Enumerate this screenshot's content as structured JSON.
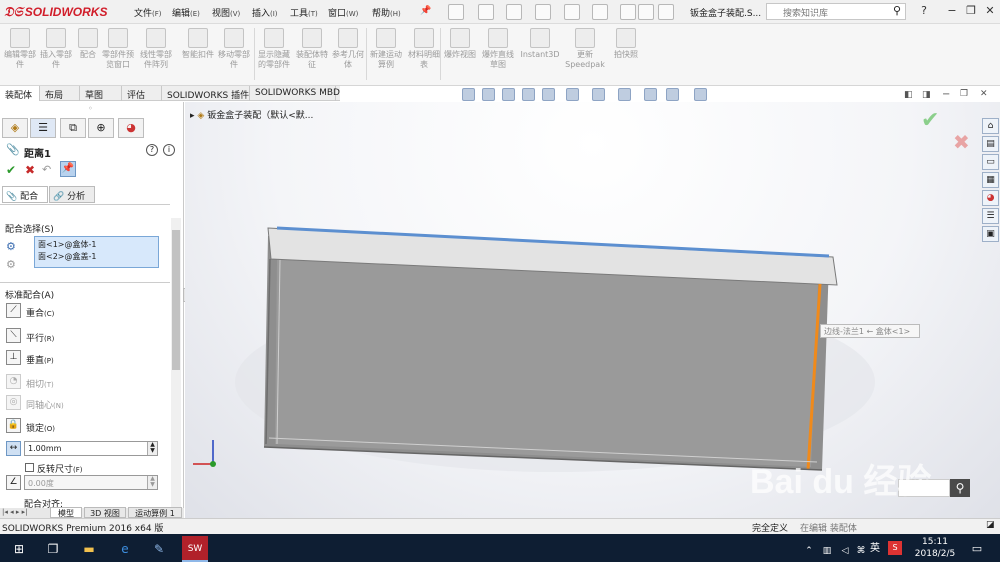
{
  "app": {
    "brand": "SOLIDWORKS",
    "document_title": "钣金盒子装配.S..."
  },
  "menu": [
    {
      "label": "文件",
      "key": "(F)"
    },
    {
      "label": "编辑",
      "key": "(E)"
    },
    {
      "label": "视图",
      "key": "(V)"
    },
    {
      "label": "插入",
      "key": "(I)"
    },
    {
      "label": "工具",
      "key": "(T)"
    },
    {
      "label": "窗口",
      "key": "(W)"
    },
    {
      "label": "帮助",
      "key": "(H)"
    }
  ],
  "search": {
    "placeholder": "搜索知识库"
  },
  "window_buttons": {
    "help": "?",
    "minimize": "−",
    "restore": "❐",
    "close": "✕"
  },
  "ribbon": [
    {
      "label": "编辑零部件"
    },
    {
      "label": "插入零部件"
    },
    {
      "label": "配合"
    },
    {
      "label": "零部件预览窗口"
    },
    {
      "label": "线性零部件阵列"
    },
    {
      "label": "智能扣件"
    },
    {
      "label": "移动零部件"
    },
    {
      "label": "显示隐藏的零部件"
    },
    {
      "label": "装配体特征"
    },
    {
      "label": "参考几何体"
    },
    {
      "label": "新建运动算例"
    },
    {
      "label": "材料明细表"
    },
    {
      "label": "爆炸视图"
    },
    {
      "label": "爆炸直线草图"
    },
    {
      "label": "Instant3D"
    },
    {
      "label": "更新Speedpak"
    },
    {
      "label": "拍快照"
    }
  ],
  "tabs": [
    "装配体",
    "布局",
    "草图",
    "评估",
    "SOLIDWORKS 插件",
    "SOLIDWORKS MBD"
  ],
  "property_manager": {
    "title": "距离1",
    "tab_mate": "配合",
    "tab_analysis": "分析",
    "section_selections": "配合选择(S)",
    "selections": [
      "面<1>@盒体-1",
      "面<2>@盒盖-1"
    ],
    "section_standard": "标准配合(A)",
    "mates": [
      {
        "label": "重合",
        "key": "(C)",
        "icon": "coincident-icon",
        "enabled": true
      },
      {
        "label": "平行",
        "key": "(R)",
        "icon": "parallel-icon",
        "enabled": true
      },
      {
        "label": "垂直",
        "key": "(P)",
        "icon": "perpendicular-icon",
        "enabled": true
      },
      {
        "label": "相切",
        "key": "(T)",
        "icon": "tangent-icon",
        "enabled": false
      },
      {
        "label": "同轴心",
        "key": "(N)",
        "icon": "concentric-icon",
        "enabled": false
      },
      {
        "label": "锁定",
        "key": "(O)",
        "icon": "lock-icon",
        "enabled": true
      }
    ],
    "distance_value": "1.00mm",
    "flip_dimension": "反转尺寸",
    "flip_key": "(F)",
    "angle_value": "0.00度",
    "mate_alignment": "配合对齐:"
  },
  "bottom_tabs": [
    "模型",
    "3D 视图",
    "运动算例 1"
  ],
  "feature_tree": {
    "root": "钣金盒子装配（默认<默..."
  },
  "tooltip": "边线-法兰1 ← 盒体<1>",
  "status": {
    "left": "SOLIDWORKS Premium 2016 x64 版",
    "right": "完全定义",
    "right2": "在编辑 装配体"
  },
  "taskbar": {
    "time": "15:11",
    "date": "2018/2/5",
    "ime": "英"
  },
  "watermark": "Bai du 经验"
}
